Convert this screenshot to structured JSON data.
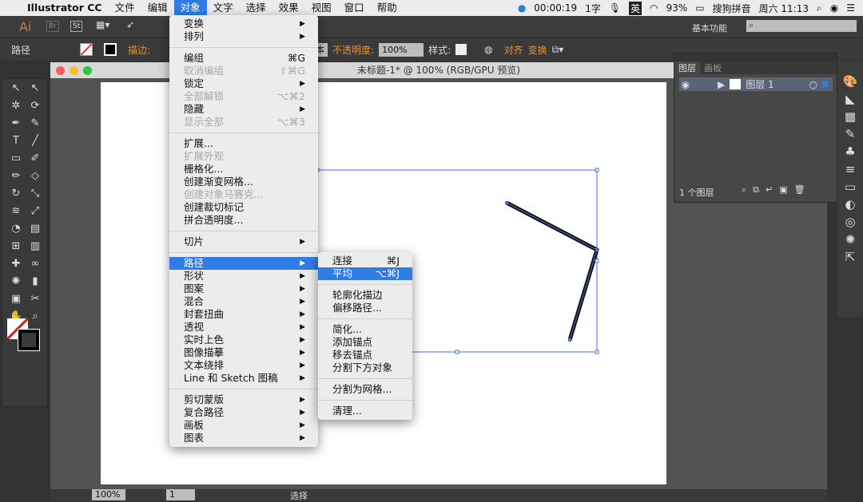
{
  "menubar": {
    "app": "Illustrator CC",
    "items": [
      "文件",
      "编辑",
      "对象",
      "文字",
      "选择",
      "效果",
      "视图",
      "窗口",
      "帮助"
    ],
    "active": "对象"
  },
  "status": {
    "timer": "00:00:19",
    "chars": "1字",
    "input_mode": "英",
    "battery": "93%",
    "ime": "搜狗拼音",
    "clock": "周六 11:13"
  },
  "appbar": {
    "logo": "Ai",
    "br": "Br",
    "st": "St",
    "workspace": "基本功能",
    "search_placeholder": ""
  },
  "control": {
    "selection": "路径",
    "stroke_label": "描边:",
    "brush": "基本",
    "opacity_label": "不透明度:",
    "opacity": "100%",
    "style_label": "样式:",
    "align": "对齐",
    "transform": "变换"
  },
  "document": {
    "title": "未标题-1* @ 100% (RGB/GPU 预览)",
    "zoom": "100%",
    "artboard": "1",
    "tool_status": "选择"
  },
  "object_menu": [
    {
      "label": "变换",
      "sub": true
    },
    {
      "label": "排列",
      "sub": true
    },
    {
      "sep": true
    },
    {
      "label": "编组",
      "key": "⌘G"
    },
    {
      "label": "取消编组",
      "key": "⇧⌘G",
      "disabled": true
    },
    {
      "label": "锁定",
      "sub": true
    },
    {
      "label": "全部解锁",
      "key": "⌥⌘2",
      "disabled": true
    },
    {
      "label": "隐藏",
      "sub": true
    },
    {
      "label": "显示全部",
      "key": "⌥⌘3",
      "disabled": true
    },
    {
      "sep": true
    },
    {
      "label": "扩展..."
    },
    {
      "label": "扩展外观",
      "disabled": true
    },
    {
      "label": "栅格化..."
    },
    {
      "label": "创建渐变网格..."
    },
    {
      "label": "创建对象马赛克...",
      "disabled": true
    },
    {
      "label": "创建裁切标记"
    },
    {
      "label": "拼合透明度..."
    },
    {
      "sep": true
    },
    {
      "label": "切片",
      "sub": true
    },
    {
      "sep": true
    },
    {
      "label": "路径",
      "sub": true,
      "highlight": true
    },
    {
      "label": "形状",
      "sub": true
    },
    {
      "label": "图案",
      "sub": true
    },
    {
      "label": "混合",
      "sub": true
    },
    {
      "label": "封套扭曲",
      "sub": true
    },
    {
      "label": "透视",
      "sub": true
    },
    {
      "label": "实时上色",
      "sub": true
    },
    {
      "label": "图像描摹",
      "sub": true
    },
    {
      "label": "文本绕排",
      "sub": true
    },
    {
      "label": "Line 和 Sketch 图稿",
      "sub": true
    },
    {
      "sep": true
    },
    {
      "label": "剪切蒙版",
      "sub": true
    },
    {
      "label": "复合路径",
      "sub": true
    },
    {
      "label": "画板",
      "sub": true
    },
    {
      "label": "图表",
      "sub": true
    }
  ],
  "path_submenu": [
    {
      "label": "连接",
      "key": "⌘J"
    },
    {
      "label": "平均",
      "key": "⌥⌘J",
      "highlight": true
    },
    {
      "sep": true
    },
    {
      "label": "轮廓化描边"
    },
    {
      "label": "偏移路径..."
    },
    {
      "sep": true
    },
    {
      "label": "简化..."
    },
    {
      "label": "添加锚点"
    },
    {
      "label": "移去锚点"
    },
    {
      "label": "分割下方对象"
    },
    {
      "sep": true
    },
    {
      "label": "分割为网格..."
    },
    {
      "sep": true
    },
    {
      "label": "清理..."
    }
  ],
  "layers_panel": {
    "tabs": [
      "图层",
      "画板"
    ],
    "layer_name": "图层 1",
    "count": "1 个图层"
  },
  "colors": {
    "accent": "#2f7ce8",
    "orange": "#e5922f",
    "selection": "#4a6fd8"
  }
}
